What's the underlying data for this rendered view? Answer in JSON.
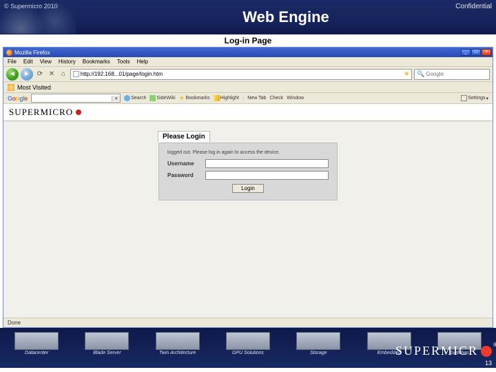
{
  "slide": {
    "copyright": "© Supermicro 2010",
    "title": "Web Engine",
    "confidential": "Confidential",
    "subtitle": "Log-in Page",
    "page_number": "13"
  },
  "browser": {
    "window_title": "Mozilla Firefox",
    "menus": {
      "file": "File",
      "edit": "Edit",
      "view": "View",
      "history": "History",
      "bookmarks": "Bookmarks",
      "tools": "Tools",
      "help": "Help"
    },
    "url_value": "http://192.168...01/page/login.htm",
    "search_engine": "Google",
    "bookmarks_label": "Most Visited",
    "google_toolbar": {
      "search_btn": "Search",
      "sidewiki": "SideWiki",
      "bookmarks": "Bookmarks",
      "highlight": "Highlight",
      "newtab": "New Tab",
      "check": "Check",
      "window": "Window",
      "settings": "Settings"
    },
    "statusbar": "Done"
  },
  "page": {
    "brand": "SUPERMICRO",
    "login_heading": "Please Login",
    "login_message": "logged out. Please log in again to access the device.",
    "username_label": "Username",
    "password_label": "Password",
    "login_button": "Login"
  },
  "footer": {
    "categories": [
      "Datacenter",
      "Blade Server",
      "Twin Architecture",
      "GPU Solutions",
      "Storage",
      "Embedded",
      "Switches"
    ],
    "brand": "SUPERMICR"
  }
}
